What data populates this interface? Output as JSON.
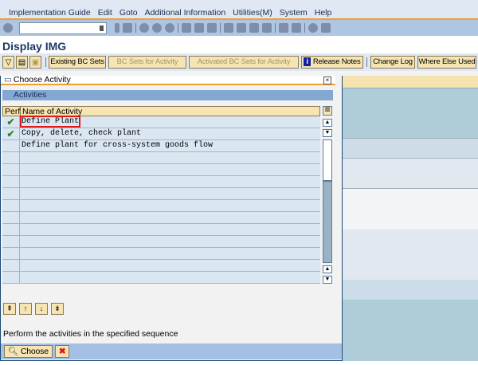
{
  "menu": [
    "Implementation Guide",
    "Edit",
    "Goto",
    "Additional Information",
    "Utilities(M)",
    "System",
    "Help"
  ],
  "command_field": {
    "value": ""
  },
  "app_title": "Display IMG",
  "app_toolbar": {
    "buttons": [
      {
        "label": "Existing BC Sets",
        "enabled": true
      },
      {
        "label": "BC Sets for Activity",
        "enabled": false
      },
      {
        "label": "Activated BC Sets for Activity",
        "enabled": false
      },
      {
        "label": "Release Notes",
        "enabled": true,
        "icon": "info-icon"
      },
      {
        "label": "Change Log",
        "enabled": true
      },
      {
        "label": "Where Else Used",
        "enabled": true
      }
    ]
  },
  "dialog": {
    "title": "Choose Activity",
    "section": "Activities",
    "columns": [
      "Perf",
      "Name of Activity"
    ],
    "rows": [
      {
        "perf": "✔",
        "name": "Define Plant",
        "selected": true
      },
      {
        "perf": "✔",
        "name": "Copy, delete, check plant"
      },
      {
        "perf": "",
        "name": "Define plant for cross-system goods flow"
      }
    ],
    "message": "Perform the activities in the specified sequence",
    "choose_label": "Choose",
    "cancel_icon": "✖"
  },
  "colors": {
    "accent": "#f0a030",
    "header": "#f6e4b2",
    "selection": "#e01818"
  }
}
